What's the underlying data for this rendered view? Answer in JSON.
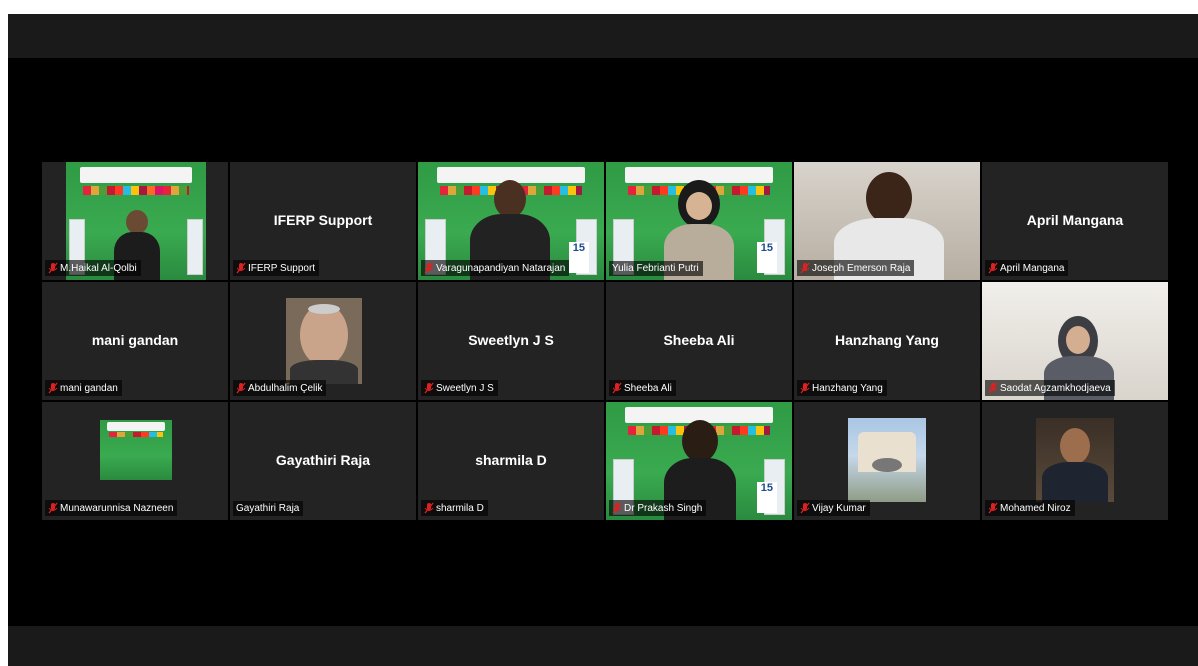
{
  "participants": [
    {
      "name": "M.Haikal Al-Qolbi",
      "muted": true,
      "display": "video"
    },
    {
      "name": "IFERP Support",
      "muted": true,
      "display": "name",
      "center_label": "IFERP Support"
    },
    {
      "name": "Varagunapandiyan Natarajan",
      "muted": true,
      "display": "video"
    },
    {
      "name": "Yulia Febrianti Putri",
      "muted": false,
      "display": "video",
      "active_speaker": true
    },
    {
      "name": "Joseph Emerson Raja",
      "muted": true,
      "display": "video"
    },
    {
      "name": "April Mangana",
      "muted": true,
      "display": "name",
      "center_label": "April Mangana"
    },
    {
      "name": "mani gandan",
      "muted": true,
      "display": "name",
      "center_label": "mani gandan"
    },
    {
      "name": "Abdulhalim Çelik",
      "muted": true,
      "display": "photo"
    },
    {
      "name": "Sweetlyn J S",
      "muted": true,
      "display": "name",
      "center_label": "Sweetlyn J S"
    },
    {
      "name": "Sheeba Ali",
      "muted": true,
      "display": "name",
      "center_label": "Sheeba Ali"
    },
    {
      "name": "Hanzhang Yang",
      "muted": true,
      "display": "name",
      "center_label": "Hanzhang Yang"
    },
    {
      "name": "Saodat Agzamkhodjaeva",
      "muted": true,
      "display": "video"
    },
    {
      "name": "Munawarunnisa Nazneen",
      "muted": true,
      "display": "photo"
    },
    {
      "name": "Gayathiri Raja",
      "muted": false,
      "display": "name",
      "center_label": "Gayathiri Raja"
    },
    {
      "name": "sharmila D",
      "muted": true,
      "display": "name",
      "center_label": "sharmila D"
    },
    {
      "name": "Dr Prakash Singh",
      "muted": true,
      "display": "video"
    },
    {
      "name": "Vijay Kumar",
      "muted": true,
      "display": "photo"
    },
    {
      "name": "Mohamed Niroz",
      "muted": true,
      "display": "photo"
    }
  ],
  "banner": {
    "badge_number": "15"
  },
  "colors": {
    "muted_icon": "#e02020",
    "active_border": "#c9d94a",
    "tile_bg": "#232323",
    "banner_green": "#3aaa50"
  }
}
